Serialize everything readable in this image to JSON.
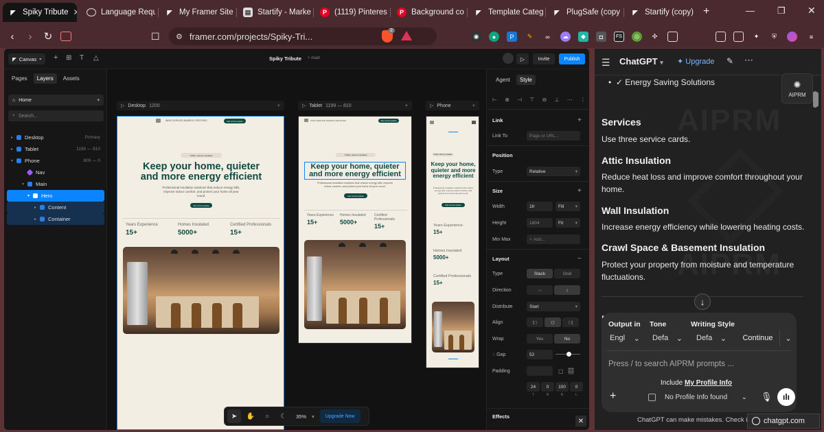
{
  "browser": {
    "tabs": [
      {
        "title": "Spiky Tribute",
        "icon": "framer-icon",
        "active": true
      },
      {
        "title": "Language Requ",
        "icon": "openai-icon"
      },
      {
        "title": "My Framer Site",
        "icon": "framer-icon"
      },
      {
        "title": "Startify - Marke",
        "icon": "page-icon"
      },
      {
        "title": "(1119) Pinteres",
        "icon": "pinterest-icon"
      },
      {
        "title": "Background co",
        "icon": "pinterest-icon"
      },
      {
        "title": "Template Categ",
        "icon": "framer-icon"
      },
      {
        "title": "PlugSafe (copy",
        "icon": "framer-icon"
      },
      {
        "title": "Startify (copy)",
        "icon": "framer-icon"
      }
    ],
    "url": "framer.com/projects/Spiky-Tri...",
    "brave_badge": "2"
  },
  "framer": {
    "menu": "Canvas",
    "project": "Spiky Tribute",
    "branch": "main",
    "invite": "Invite",
    "publish": "Publish",
    "left_tabs": [
      "Pages",
      "Layers",
      "Assets"
    ],
    "page_select": "Home",
    "search_placeholder": "Search...",
    "layers": [
      {
        "name": "Desktop",
        "meta": "Primary",
        "indent": 0
      },
      {
        "name": "Tablet",
        "meta": "1199 — 810",
        "indent": 0
      },
      {
        "name": "Phone",
        "meta": "809 — 0",
        "indent": 0
      },
      {
        "name": "Nav",
        "meta": "",
        "indent": 1
      },
      {
        "name": "Main",
        "meta": "",
        "indent": 1
      },
      {
        "name": "Hero",
        "meta": "",
        "indent": 2,
        "selected": true
      },
      {
        "name": "Content",
        "meta": "",
        "indent": 3
      },
      {
        "name": "Container",
        "meta": "",
        "indent": 3
      }
    ],
    "breakpoints": [
      {
        "name": "Desktop",
        "size": "1200"
      },
      {
        "name": "Tablet",
        "size": "1199 — 810"
      },
      {
        "name": "Phone",
        "size": ""
      }
    ],
    "site": {
      "nav_text": "WINS SERVICE AWARDS CERTIFIED",
      "cta": "Get a Free Quote",
      "badge": "5,000+ Homes Insulated",
      "headline": "Keep your home, quieter and more energy efficient",
      "sub": "Professional insulation solutions that reduce energy bills, improve indoor comfort, and protect your home all year round.",
      "stats": [
        {
          "label": "Years Experience",
          "value": "15+"
        },
        {
          "label": "Homes Insulated",
          "value": "5000+"
        },
        {
          "label": "Certified Professionals",
          "value": "15+"
        }
      ]
    },
    "right_tabs": [
      "Agent",
      "Style"
    ],
    "link": {
      "title": "Link",
      "label": "Link To",
      "placeholder": "Page or URL..."
    },
    "position": {
      "title": "Position",
      "label": "Type",
      "value": "Relative"
    },
    "size": {
      "title": "Size",
      "width_label": "Width",
      "width": "1fr",
      "width_mode": "Fill",
      "height_label": "Height",
      "height": "1804",
      "height_mode": "Fit",
      "max_label": "Min Max",
      "max_value": "Add..."
    },
    "layout": {
      "title": "Layout",
      "type_label": "Type",
      "stack": "Stack",
      "grid": "Grid",
      "direction_label": "Direction",
      "distribute_label": "Distribute",
      "distribute": "Start",
      "align_label": "Align",
      "wrap_label": "Wrap",
      "wrap_yes": "Yes",
      "wrap_no": "No",
      "gap_label": "Gap",
      "gap": "52",
      "gap_slider": 0.52,
      "padding_label": "Padding",
      "padding_values": [
        "24",
        "0",
        "100",
        "0"
      ],
      "padding_sides": [
        "T",
        "R",
        "B",
        "L"
      ]
    },
    "effects": "Effects",
    "zoom": "35%",
    "upgrade": "Upgrade Now"
  },
  "chatgpt": {
    "model": "ChatGPT",
    "upgrade": "Upgrade",
    "aiprm_badge": "AIPRM",
    "watermark": "AIPRM",
    "bullet": "✓ Energy Saving Solutions",
    "sections": [
      {
        "title": "Services",
        "body": "Use three service cards."
      },
      {
        "title": "Attic Insulation",
        "body": "Reduce heat loss and improve comfort throughout your home."
      },
      {
        "title": "Wall Insulation",
        "body": "Increase energy efficiency while lowering heating costs."
      },
      {
        "title": "Crawl Space & Basement Insulation",
        "body": "Protect your property from moisture and temperature fluctuations."
      }
    ],
    "peek_letter": "F",
    "prompt_bar": {
      "output_label": "Output in",
      "output_value": "Engl",
      "tone_label": "Tone",
      "tone_value": "Defa",
      "style_label": "Writing Style",
      "style_value": "Defa",
      "continue": "Continue",
      "placeholder": "Press / to search AIPRM prompts ...",
      "include_prefix": "Include",
      "include_link": "My Profile Info",
      "profile_select": "No Profile Info found"
    },
    "disclaimer": "ChatGPT can make mistakes. Check impor",
    "popup": "chatgpt.com"
  }
}
